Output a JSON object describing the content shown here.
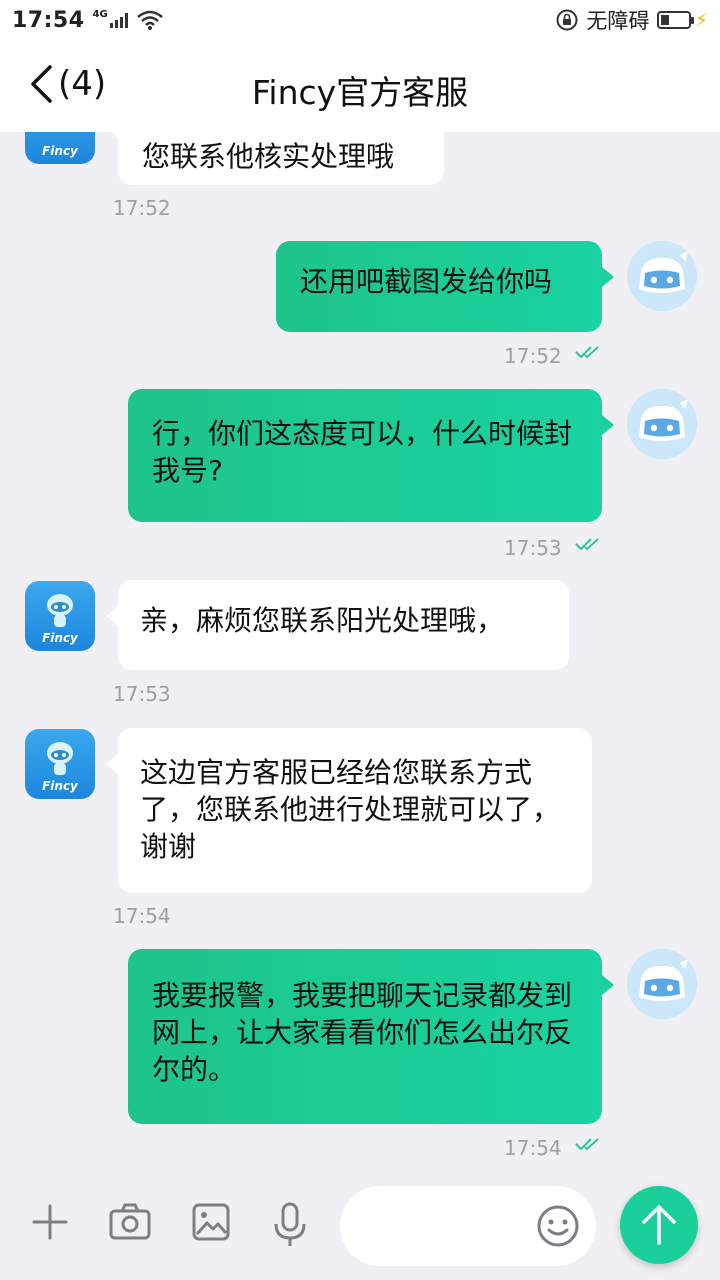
{
  "status": {
    "time": "17:54",
    "network": "4G",
    "accessibility": "无障碍"
  },
  "header": {
    "back_count": "(4)",
    "title": "Fincy官方客服"
  },
  "bot": {
    "brand": "Fincy"
  },
  "messages": [
    {
      "from": "bot",
      "text": "您联系他核实处理哦",
      "time": "17:52"
    },
    {
      "from": "me",
      "text": "还用吧截图发给你吗",
      "time": "17:52"
    },
    {
      "from": "me",
      "text": "行，你们这态度可以，什么时候封我号?",
      "time": "17:53"
    },
    {
      "from": "bot",
      "text": "亲，麻烦您联系阳光处理哦，",
      "time": "17:53"
    },
    {
      "from": "bot",
      "text": "这边官方客服已经给您联系方式了，您联系他进行处理就可以了，谢谢",
      "time": "17:54"
    },
    {
      "from": "me",
      "text": "我要报警，我要把聊天记录都发到网上，让大家看看你们怎么出尔反尔的。",
      "time": "17:54"
    }
  ],
  "colors": {
    "accent": "#1bcf9b",
    "background": "#efeff4",
    "timestamp": "#9aa0a6"
  },
  "icons": [
    "back-chevron-icon",
    "plus-icon",
    "camera-icon",
    "image-icon",
    "microphone-icon",
    "emoji-icon",
    "send-arrow-icon",
    "read-check-icon"
  ]
}
